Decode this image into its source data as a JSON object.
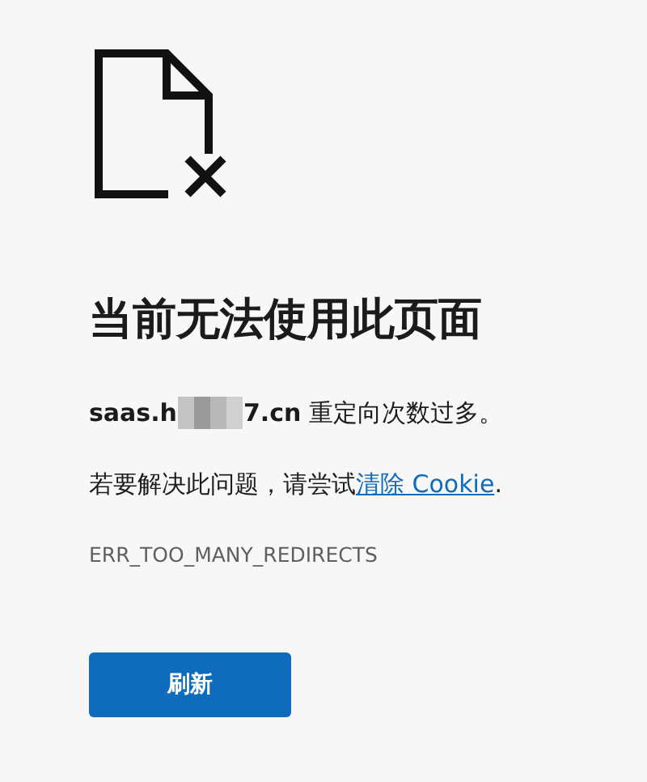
{
  "title": "当前无法使用此页面",
  "message": {
    "host_start": "saas.h",
    "host_redacted": true,
    "host_end": "7.cn",
    "text": "重定向次数过多。"
  },
  "suggestion": {
    "text": "若要解决此问题，请尝试",
    "link": "清除 Cookie",
    "end": "."
  },
  "error_code": "ERR_TOO_MANY_REDIRECTS",
  "button": "刷新"
}
